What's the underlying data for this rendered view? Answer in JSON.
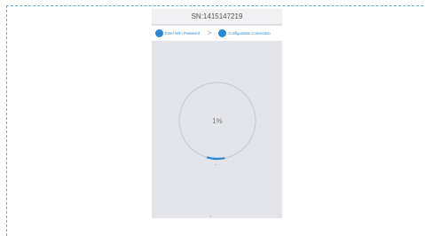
{
  "device": {
    "title": "SN:1415147219"
  },
  "steps": [
    {
      "label": "Enter WiFi Password"
    },
    {
      "label": "Configuration Connection"
    }
  ],
  "step_separator": ">",
  "progress": {
    "label": "1%",
    "fraction": 0.01
  },
  "colors": {
    "accent": "#2a86d6",
    "screen_bg": "#e4e5ea",
    "frame_dash": "#5aa9e6"
  }
}
